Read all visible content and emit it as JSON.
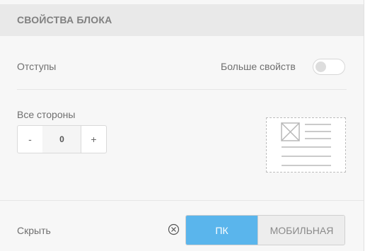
{
  "header": {
    "title": "СВОЙСТВА БЛОКА"
  },
  "padding_row": {
    "label": "Отступы",
    "more_label": "Больше свойств",
    "more_toggle_on": false
  },
  "all_sides": {
    "label": "Все стороны",
    "minus": "-",
    "value": "0",
    "plus": "+"
  },
  "preview": {
    "icon": "block-layout-preview-icon"
  },
  "hide_row": {
    "label": "Скрыть",
    "clear_icon": "circle-x-icon",
    "options": [
      "ПК",
      "МОБИЛЬНАЯ"
    ],
    "selected": "ПК"
  },
  "colors": {
    "accent": "#5ab5ec",
    "header_bg": "#e9e9e9",
    "panel_bg": "#f7f7f7"
  }
}
